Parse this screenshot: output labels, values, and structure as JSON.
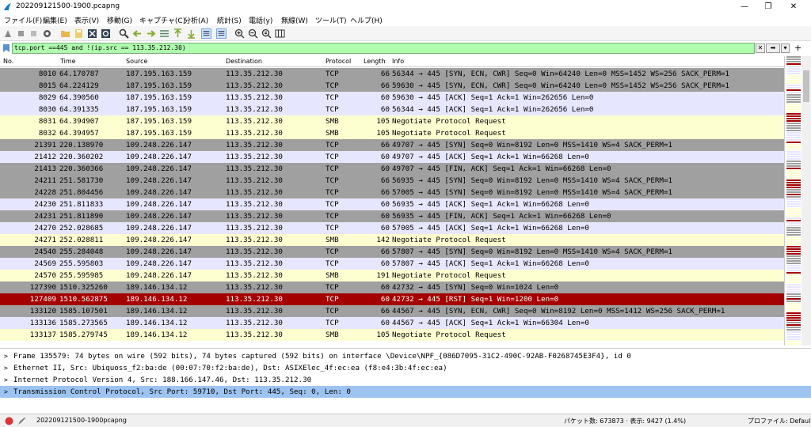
{
  "window": {
    "title": "202209121500-1900.pcapng"
  },
  "menu": [
    "ファイル(F)",
    "編集(E)",
    "表示(V)",
    "移動(G)",
    "キャプチャ(C)",
    "分析(A)",
    "統計(S)",
    "電話(y)",
    "無線(W)",
    "ツール(T)",
    "ヘルプ(H)"
  ],
  "filter": {
    "value": "tcp.port ==445 and !(ip.src == 113.35.212.30)"
  },
  "columns": [
    "No.",
    "Time",
    "Source",
    "Destination",
    "Protocol",
    "Length",
    "Info"
  ],
  "packets": [
    {
      "no": "8010",
      "time": "64.170787",
      "src": "187.195.163.159",
      "dst": "113.35.212.30",
      "proto": "TCP",
      "len": "66",
      "info": "56344 → 445 [SYN, ECN, CWR] Seq=0 Win=64240 Len=0 MSS=1452 WS=256 SACK_PERM=1",
      "style": "syn"
    },
    {
      "no": "8015",
      "time": "64.224129",
      "src": "187.195.163.159",
      "dst": "113.35.212.30",
      "proto": "TCP",
      "len": "66",
      "info": "59630 → 445 [SYN, ECN, CWR] Seq=0 Win=64240 Len=0 MSS=1452 WS=256 SACK_PERM=1",
      "style": "syn"
    },
    {
      "no": "8029",
      "time": "64.390560",
      "src": "187.195.163.159",
      "dst": "113.35.212.30",
      "proto": "TCP",
      "len": "60",
      "info": "59630 → 445 [ACK] Seq=1 Ack=1 Win=262656 Len=0",
      "style": "tcp"
    },
    {
      "no": "8030",
      "time": "64.391335",
      "src": "187.195.163.159",
      "dst": "113.35.212.30",
      "proto": "TCP",
      "len": "60",
      "info": "56344 → 445 [ACK] Seq=1 Ack=1 Win=262656 Len=0",
      "style": "tcp"
    },
    {
      "no": "8031",
      "time": "64.394907",
      "src": "187.195.163.159",
      "dst": "113.35.212.30",
      "proto": "SMB",
      "len": "105",
      "info": "Negotiate Protocol Request",
      "style": "smb"
    },
    {
      "no": "8032",
      "time": "64.394957",
      "src": "187.195.163.159",
      "dst": "113.35.212.30",
      "proto": "SMB",
      "len": "105",
      "info": "Negotiate Protocol Request",
      "style": "smb"
    },
    {
      "no": "21391",
      "time": "220.138970",
      "src": "109.248.226.147",
      "dst": "113.35.212.30",
      "proto": "TCP",
      "len": "66",
      "info": "49707 → 445 [SYN] Seq=0 Win=8192 Len=0 MSS=1410 WS=4 SACK_PERM=1",
      "style": "syn"
    },
    {
      "no": "21412",
      "time": "220.360202",
      "src": "109.248.226.147",
      "dst": "113.35.212.30",
      "proto": "TCP",
      "len": "60",
      "info": "49707 → 445 [ACK] Seq=1 Ack=1 Win=66268 Len=0",
      "style": "tcp"
    },
    {
      "no": "21413",
      "time": "220.360366",
      "src": "109.248.226.147",
      "dst": "113.35.212.30",
      "proto": "TCP",
      "len": "60",
      "info": "49707 → 445 [FIN, ACK] Seq=1 Ack=1 Win=66268 Len=0",
      "style": "syn"
    },
    {
      "no": "24211",
      "time": "251.581730",
      "src": "109.248.226.147",
      "dst": "113.35.212.30",
      "proto": "TCP",
      "len": "66",
      "info": "56935 → 445 [SYN] Seq=0 Win=8192 Len=0 MSS=1410 WS=4 SACK_PERM=1",
      "style": "syn"
    },
    {
      "no": "24228",
      "time": "251.804456",
      "src": "109.248.226.147",
      "dst": "113.35.212.30",
      "proto": "TCP",
      "len": "66",
      "info": "57005 → 445 [SYN] Seq=0 Win=8192 Len=0 MSS=1410 WS=4 SACK_PERM=1",
      "style": "syn"
    },
    {
      "no": "24230",
      "time": "251.811833",
      "src": "109.248.226.147",
      "dst": "113.35.212.30",
      "proto": "TCP",
      "len": "60",
      "info": "56935 → 445 [ACK] Seq=1 Ack=1 Win=66268 Len=0",
      "style": "tcp"
    },
    {
      "no": "24231",
      "time": "251.811890",
      "src": "109.248.226.147",
      "dst": "113.35.212.30",
      "proto": "TCP",
      "len": "60",
      "info": "56935 → 445 [FIN, ACK] Seq=1 Ack=1 Win=66268 Len=0",
      "style": "syn"
    },
    {
      "no": "24270",
      "time": "252.028685",
      "src": "109.248.226.147",
      "dst": "113.35.212.30",
      "proto": "TCP",
      "len": "60",
      "info": "57005 → 445 [ACK] Seq=1 Ack=1 Win=66268 Len=0",
      "style": "tcp"
    },
    {
      "no": "24271",
      "time": "252.028811",
      "src": "109.248.226.147",
      "dst": "113.35.212.30",
      "proto": "SMB",
      "len": "142",
      "info": "Negotiate Protocol Request",
      "style": "smb"
    },
    {
      "no": "24540",
      "time": "255.284048",
      "src": "109.248.226.147",
      "dst": "113.35.212.30",
      "proto": "TCP",
      "len": "66",
      "info": "57807 → 445 [SYN] Seq=0 Win=8192 Len=0 MSS=1410 WS=4 SACK_PERM=1",
      "style": "syn"
    },
    {
      "no": "24569",
      "time": "255.595803",
      "src": "109.248.226.147",
      "dst": "113.35.212.30",
      "proto": "TCP",
      "len": "60",
      "info": "57807 → 445 [ACK] Seq=1 Ack=1 Win=66268 Len=0",
      "style": "tcp"
    },
    {
      "no": "24570",
      "time": "255.595985",
      "src": "109.248.226.147",
      "dst": "113.35.212.30",
      "proto": "SMB",
      "len": "191",
      "info": "Negotiate Protocol Request",
      "style": "smb"
    },
    {
      "no": "127390",
      "time": "1510.325260",
      "src": "189.146.134.12",
      "dst": "113.35.212.30",
      "proto": "TCP",
      "len": "60",
      "info": "42732 → 445 [SYN] Seq=0 Win=1024 Len=0",
      "style": "syn"
    },
    {
      "no": "127409",
      "time": "1510.562875",
      "src": "189.146.134.12",
      "dst": "113.35.212.30",
      "proto": "TCP",
      "len": "60",
      "info": "42732 → 445 [RST] Seq=1 Win=1200 Len=0",
      "style": "rst"
    },
    {
      "no": "133120",
      "time": "1585.107501",
      "src": "189.146.134.12",
      "dst": "113.35.212.30",
      "proto": "TCP",
      "len": "66",
      "info": "44567 → 445 [SYN, ECN, CWR] Seq=0 Win=8192 Len=0 MSS=1412 WS=256 SACK_PERM=1",
      "style": "syn"
    },
    {
      "no": "133136",
      "time": "1585.273565",
      "src": "189.146.134.12",
      "dst": "113.35.212.30",
      "proto": "TCP",
      "len": "60",
      "info": "44567 → 445 [ACK] Seq=1 Ack=1 Win=66304 Len=0",
      "style": "tcp"
    },
    {
      "no": "133137",
      "time": "1585.279745",
      "src": "189.146.134.12",
      "dst": "113.35.212.30",
      "proto": "SMB",
      "len": "105",
      "info": "Negotiate Protocol Request",
      "style": "smb"
    }
  ],
  "details": [
    {
      "text": "Frame 135579: 74 bytes on wire (592 bits), 74 bytes captured (592 bits) on interface \\Device\\NPF_{086D7095-31C2-490C-92AB-F0268745E3F4}, id 0",
      "selected": false
    },
    {
      "text": "Ethernet II, Src: Ubiquoss_f2:ba:de (00:07:70:f2:ba:de), Dst: ASIXElec_4f:ec:ea (f8:e4:3b:4f:ec:ea)",
      "selected": false
    },
    {
      "text": "Internet Protocol Version 4, Src: 188.166.147.46, Dst: 113.35.212.30",
      "selected": false
    },
    {
      "text": "Transmission Control Protocol, Src Port: 59710, Dst Port: 445, Seq: 0, Len: 0",
      "selected": true
    }
  ],
  "status": {
    "file": "202209121500-1900pcapng",
    "packets": "パケット数: 673873 · 表示: 9427 (1.4%)",
    "profile": "プロファイル: Default"
  },
  "colors": {
    "syn": "#a0a0a0",
    "tcp": "#e7e6ff",
    "smb": "#feffd0",
    "rst": "#a40000",
    "selected": "#9dc3f0"
  }
}
